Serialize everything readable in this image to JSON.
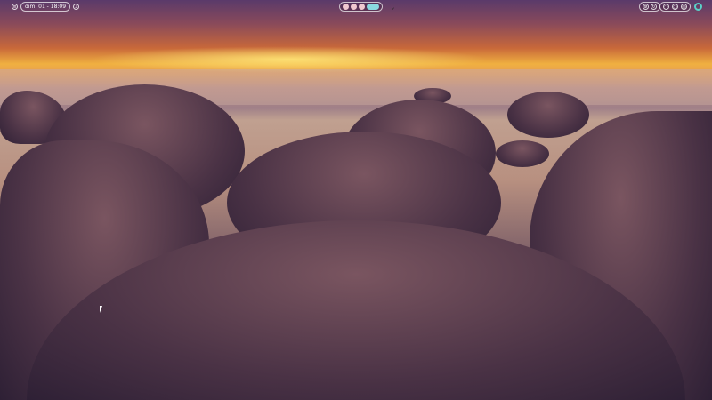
{
  "topbar": {
    "clock": "dim. 01 - 18:09",
    "left_icons": [
      "menu-icon",
      "bell-icon"
    ],
    "workspaces": [
      {
        "active": false
      },
      {
        "active": false
      },
      {
        "active": false
      },
      {
        "active": true
      }
    ],
    "right_icons": [
      "settings-icon",
      "refresh-icon",
      "gauge-icon",
      "cpu-icon",
      "memory-icon",
      "power-icon"
    ],
    "accent": "#8ad8e0"
  }
}
